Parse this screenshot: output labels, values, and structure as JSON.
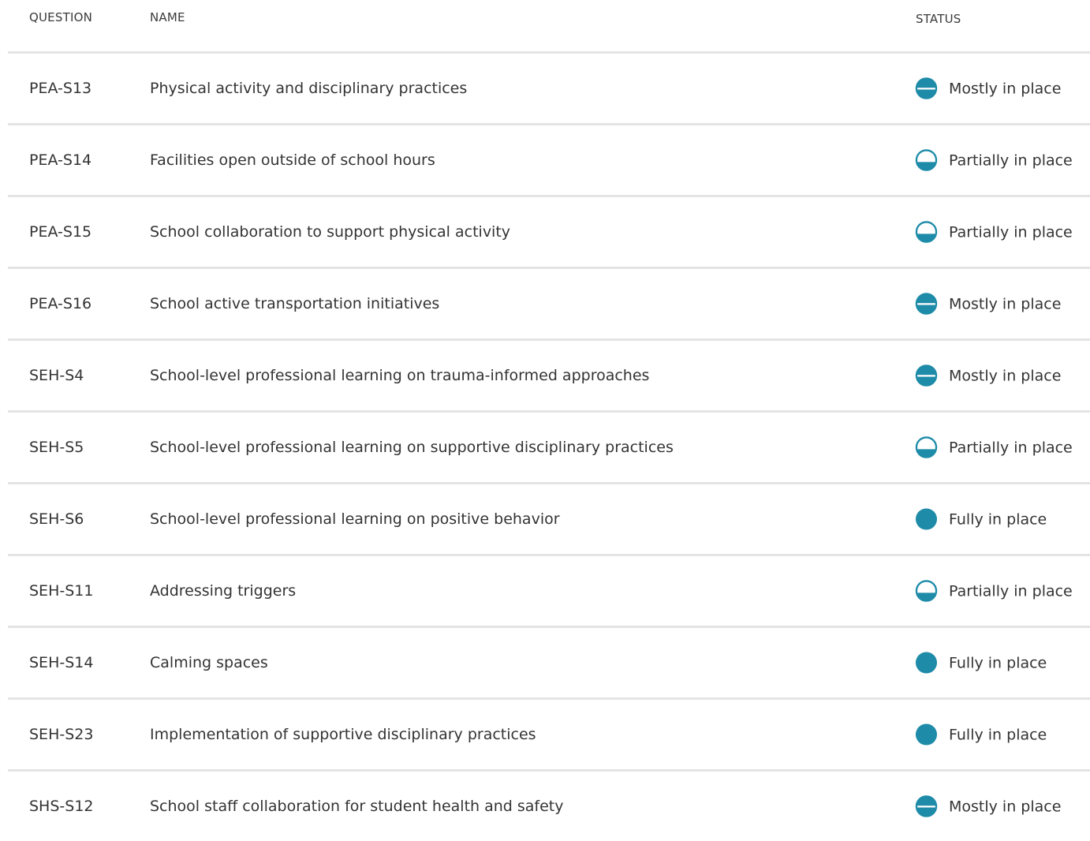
{
  "colors": {
    "accent": "#1e8ba8",
    "divider": "#e4e4e4"
  },
  "header": {
    "question": "QUESTION",
    "name": "NAME",
    "status": "STATUS"
  },
  "rows": [
    {
      "question": "PEA-S13",
      "name": "Physical activity and disciplinary practices",
      "status": "Mostly in place",
      "icon": "mostly-in-place-icon"
    },
    {
      "question": "PEA-S14",
      "name": "Facilities open outside of school hours",
      "status": "Partially in place",
      "icon": "partially-in-place-icon"
    },
    {
      "question": "PEA-S15",
      "name": "School collaboration to support physical activity",
      "status": "Partially in place",
      "icon": "partially-in-place-icon"
    },
    {
      "question": "PEA-S16",
      "name": "School active transportation initiatives",
      "status": "Mostly in place",
      "icon": "mostly-in-place-icon"
    },
    {
      "question": "SEH-S4",
      "name": "School-level professional learning on trauma-informed approaches",
      "status": "Mostly in place",
      "icon": "mostly-in-place-icon"
    },
    {
      "question": "SEH-S5",
      "name": "School-level professional learning on supportive disciplinary practices",
      "status": "Partially in place",
      "icon": "partially-in-place-icon"
    },
    {
      "question": "SEH-S6",
      "name": "School-level professional learning on positive behavior",
      "status": "Fully in place",
      "icon": "fully-in-place-icon"
    },
    {
      "question": "SEH-S11",
      "name": "Addressing triggers",
      "status": "Partially in place",
      "icon": "partially-in-place-icon"
    },
    {
      "question": "SEH-S14",
      "name": "Calming spaces",
      "status": "Fully in place",
      "icon": "fully-in-place-icon"
    },
    {
      "question": "SEH-S23",
      "name": "Implementation of supportive disciplinary practices",
      "status": "Fully in place",
      "icon": "fully-in-place-icon"
    },
    {
      "question": "SHS-S12",
      "name": "School staff collaboration for student health and safety",
      "status": "Mostly in place",
      "icon": "mostly-in-place-icon"
    }
  ]
}
